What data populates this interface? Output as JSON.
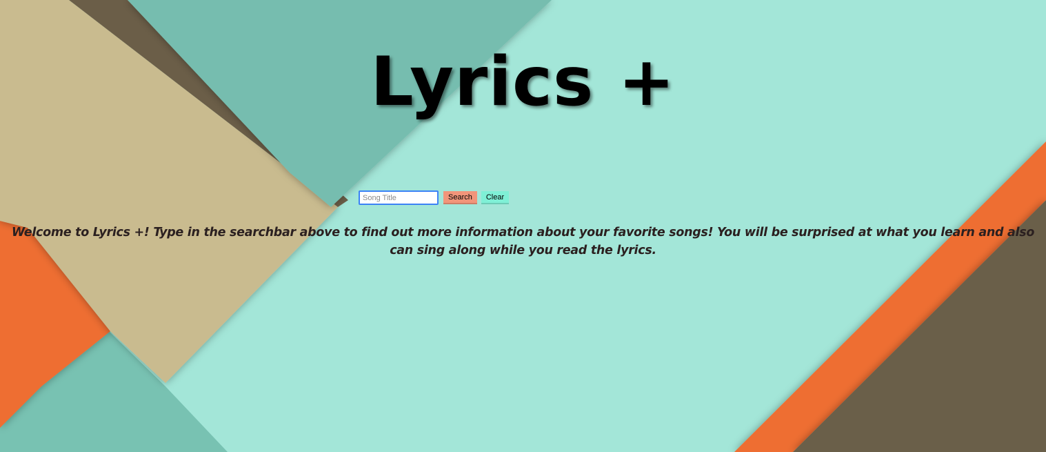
{
  "page": {
    "title": "Lyrics +",
    "welcome_text": "Welcome to Lyrics +! Type in the searchbar above to find out more information about your favorite songs! You will be surprised at what you learn and also can sing along while you read the lyrics."
  },
  "search": {
    "placeholder": "Song Title",
    "value": "",
    "search_label": "Search",
    "clear_label": "Clear"
  },
  "colors": {
    "background_teal": "#a3e6d8",
    "dark_teal": "#74bcae",
    "tan": "#c9bb8f",
    "brown": "#6b5e48",
    "orange": "#ee6e33",
    "search_button": "#f2957a",
    "clear_button": "#7ff0d6",
    "input_focus_border": "#3b82f6"
  }
}
